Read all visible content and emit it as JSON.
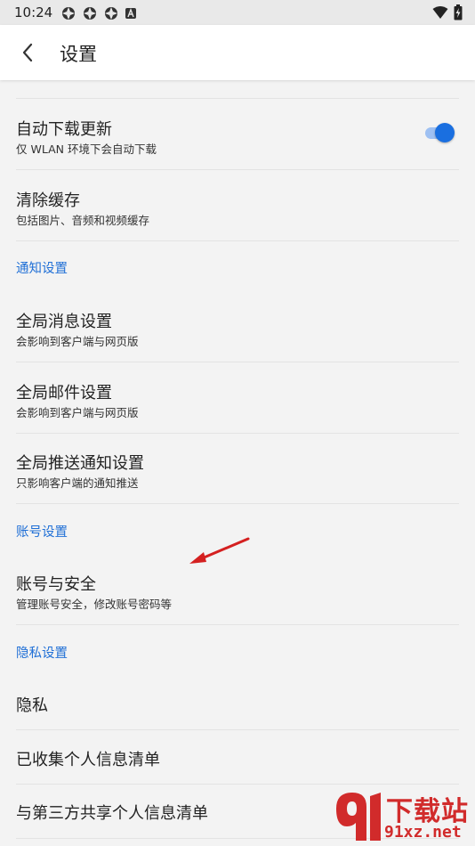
{
  "status": {
    "time": "10:24"
  },
  "header": {
    "title": "设置"
  },
  "rows": [
    {
      "title": "自动下载更新",
      "subtitle": "仅 WLAN 环境下会自动下载"
    },
    {
      "title": "清除缓存",
      "subtitle": "包括图片、音频和视频缓存"
    },
    {
      "title": "全局消息设置",
      "subtitle": "会影响到客户端与网页版"
    },
    {
      "title": "全局邮件设置",
      "subtitle": "会影响到客户端与网页版"
    },
    {
      "title": "全局推送通知设置",
      "subtitle": "只影响客户端的通知推送"
    },
    {
      "title": "账号与安全",
      "subtitle": "管理账号安全，修改账号密码等"
    },
    {
      "title": "隐私"
    },
    {
      "title": "已收集个人信息清单"
    },
    {
      "title": "与第三方共享个人信息清单"
    }
  ],
  "sections": {
    "notify": "通知设置",
    "account": "账号设置",
    "privacy": "隐私设置"
  },
  "toggle": {
    "auto_download_on": true
  },
  "watermark": {
    "brand": "下载站",
    "url": "91xz.net"
  },
  "colors": {
    "accent": "#1f6fd6",
    "toggle": "#1a6fe0",
    "annotation_arrow": "#d42020"
  }
}
